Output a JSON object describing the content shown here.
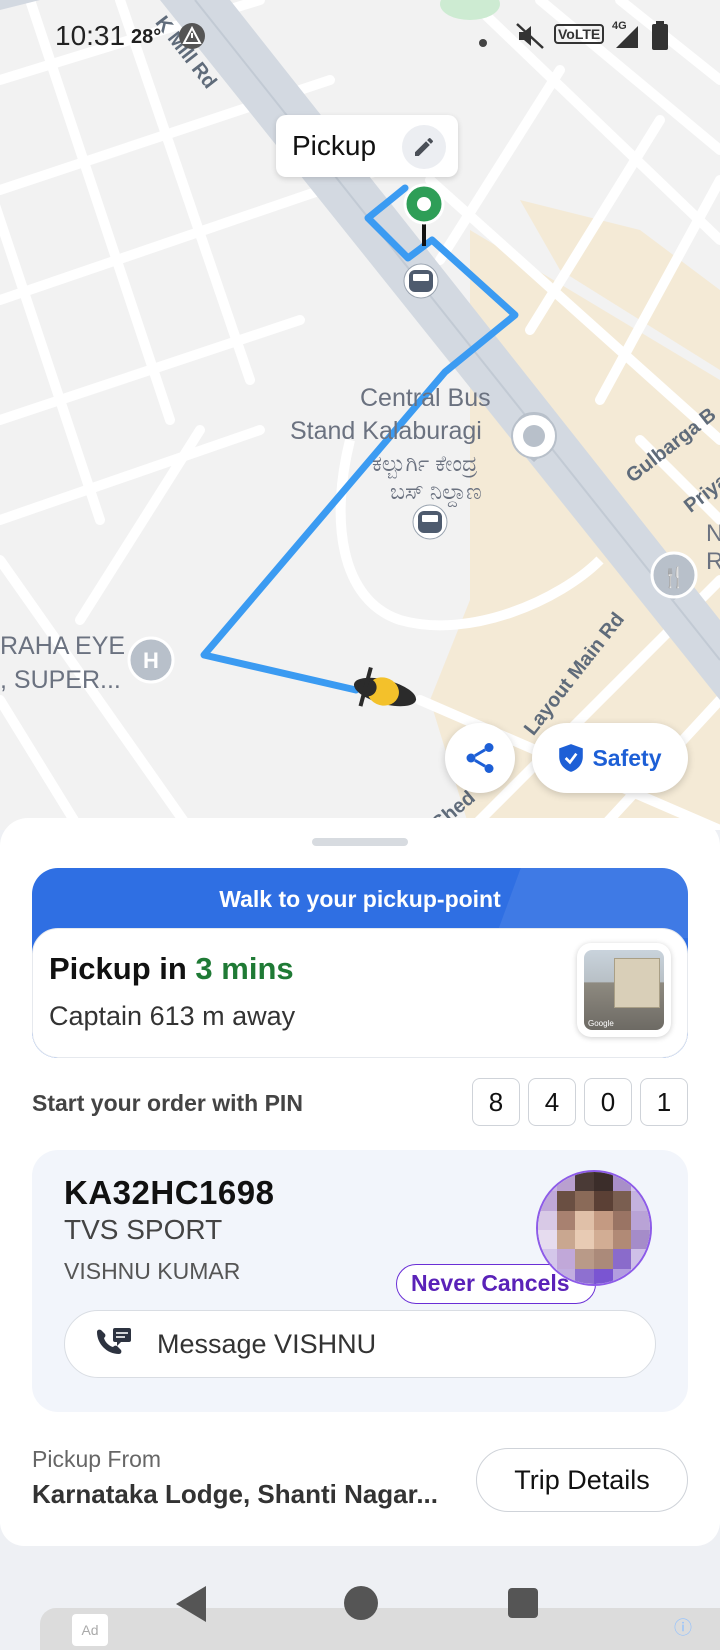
{
  "status_bar": {
    "time": "10:31",
    "temperature": "28°",
    "network": "4G",
    "volte": "VoLTE"
  },
  "map": {
    "pickup_label": "Pickup",
    "bus_stand_en": "Central Bus Stand Kalaburagi",
    "bus_stand_line1": "Central Bus",
    "bus_stand_line2": "Stand Kalaburagi",
    "bus_stand_kn1": "ಕಲ್ಬುರ್ಗಿ ಕೇಂದ್ರ",
    "bus_stand_kn2": "ಬಸ್ ನಿಲ್ದಾಣ",
    "hospital_line1": "RAHA EYE",
    "hospital_line2": ", SUPER...",
    "road_mill": "K Mill Rd",
    "road_gulbarga": "Gulbarga B",
    "road_priya": "Priya",
    "road_layout": "Layout Main Rd",
    "road_shed": "Shed",
    "poi_right": "N\nR",
    "route_color": "#3b9bf2",
    "pickup_pin_color": "#2e9e57"
  },
  "map_buttons": {
    "share_icon": "share-icon",
    "safety_label": "Safety"
  },
  "sheet": {
    "banner": "Walk to your pickup-point",
    "eta_prefix": "Pickup in ",
    "eta_value": "3 mins",
    "captain_distance": "Captain 613 m away",
    "pin_label": "Start your order with PIN",
    "pin_digits": [
      "8",
      "4",
      "0",
      "1"
    ],
    "driver": {
      "plate": "KA32HC1698",
      "vehicle": "TVS SPORT",
      "name": "VISHNU KUMAR",
      "badge": "Never Cancels",
      "message_button": "Message VISHNU"
    },
    "pickup_from_label": "Pickup From",
    "pickup_from_value": "Karnataka Lodge, Shanti Nagar...",
    "trip_details": "Trip Details"
  },
  "ad": {
    "ad_label": "Ad",
    "info_icon": "ⓘ"
  }
}
